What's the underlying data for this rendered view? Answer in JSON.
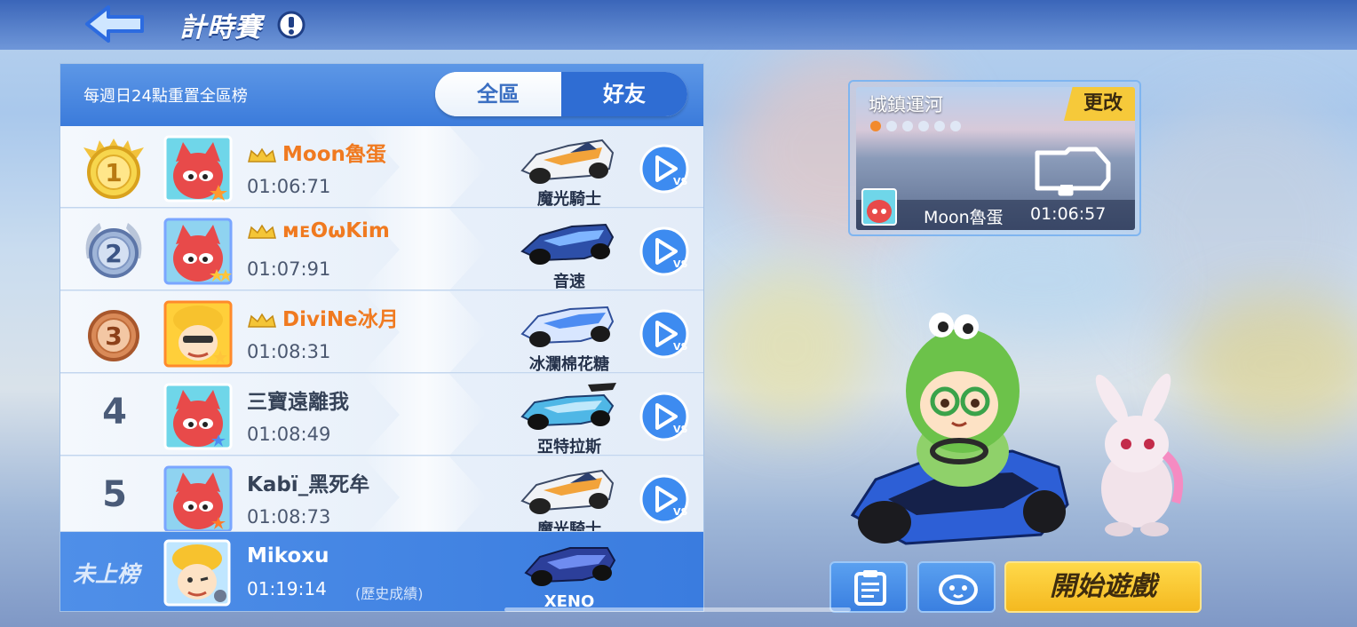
{
  "header": {
    "title": "計時賽"
  },
  "leaderboard": {
    "reset_note": "每週日24點重置全區榜",
    "tabs": [
      {
        "label": "全區",
        "active": false
      },
      {
        "label": "好友",
        "active": true
      }
    ],
    "rows": [
      {
        "rank": "1",
        "name": "Moon魯蛋",
        "time": "01:06:71",
        "kart": "魔光騎士",
        "medal": "gold",
        "gold_name": true
      },
      {
        "rank": "2",
        "name": "ᴍᴇʘωKim",
        "time": "01:07:91",
        "kart": "音速",
        "medal": "silver",
        "gold_name": true
      },
      {
        "rank": "3",
        "name": "DiviNe冰月",
        "time": "01:08:31",
        "kart": "冰瀾棉花糖",
        "medal": "bronze",
        "gold_name": true
      },
      {
        "rank": "4",
        "name": "三寶遠離我",
        "time": "01:08:49",
        "kart": "亞特拉斯",
        "medal": "none",
        "gold_name": false
      },
      {
        "rank": "5",
        "name": "Kabï_黑死牟",
        "time": "01:08:73",
        "kart": "魔光騎士",
        "medal": "none",
        "gold_name": false
      }
    ],
    "me": {
      "status": "未上榜",
      "name": "Mikoxu",
      "time": "01:19:14",
      "history_label": "(歷史成績)",
      "kart": "XENO"
    }
  },
  "track": {
    "name": "城鎮運河",
    "change_label": "更改",
    "record_holder": "Moon魯蛋",
    "record_time": "01:06:57"
  },
  "actions": {
    "start_label": "開始遊戲"
  },
  "colors": {
    "header_blue": "#3b7bdb",
    "gold_name": "#f07a20",
    "start_yellow": "#f4b920",
    "friends_tab": "#2f6dd3"
  },
  "icons": [
    "back-arrow-icon",
    "info-icon",
    "medal-icon",
    "crown-icon",
    "vs-play-icon",
    "clipboard-icon",
    "mascot-icon",
    "track-map-icon"
  ]
}
